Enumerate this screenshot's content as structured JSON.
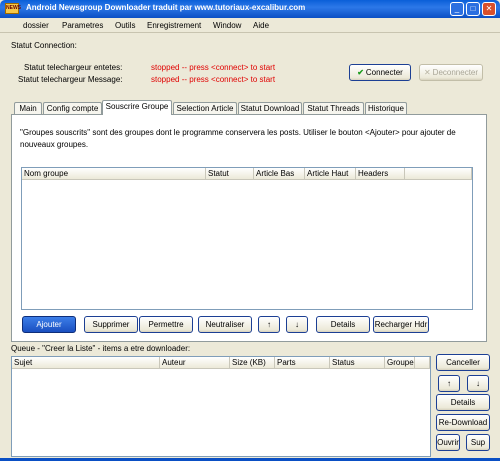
{
  "window": {
    "app_icon_text": "NEWS",
    "title": "Android Newsgroup Downloader traduit par www.tutoriaux-excalibur.com",
    "min_glyph": "_",
    "max_glyph": "□",
    "close_glyph": "✕"
  },
  "menu": [
    "dossier",
    "Parametres",
    "Outils",
    "Enregistrement",
    "Window",
    "Aide"
  ],
  "connection": {
    "section_label": "Statut Connection:",
    "headers_label": "Statut telechargeur entetes:",
    "headers_value": "stopped -- press <connect> to start",
    "message_label": "Statut telechargeur Message:",
    "message_value": "stopped -- press <connect> to start",
    "connect_label": "Connecter",
    "disconnect_label": "Deconnecter"
  },
  "tabs": [
    "Main",
    "Config compte",
    "Souscrire Groupe",
    "Selection Article",
    "Statut Download",
    "Statut Threads",
    "Historique"
  ],
  "groups_panel": {
    "description": "\"Groupes souscrits\" sont des groupes dont le programme conservera les posts. Utiliser le bouton <Ajouter> pour ajouter de nouveaux groupes.",
    "columns": [
      "Nom groupe",
      "Statut",
      "Article Bas",
      "Article Haut",
      "Headers",
      ""
    ],
    "buttons": {
      "add": "Ajouter",
      "delete": "Supprimer",
      "allow": "Permettre",
      "neutralize": "Neutraliser",
      "up": "↑",
      "down": "↓",
      "details": "Details",
      "reload": "Recharger Hdr"
    }
  },
  "queue": {
    "label": "Queue - \"Creer la Liste\" - items a etre downloader:",
    "columns": [
      "Sujet",
      "Auteur",
      "Size (KB)",
      "Parts",
      "Status",
      "Groupe",
      ""
    ],
    "buttons": {
      "cancel": "Canceller",
      "up": "↑",
      "down": "↓",
      "details": "Details",
      "redownload": "Re-Download",
      "open": "Ouvrir",
      "delete": "Sup"
    }
  }
}
